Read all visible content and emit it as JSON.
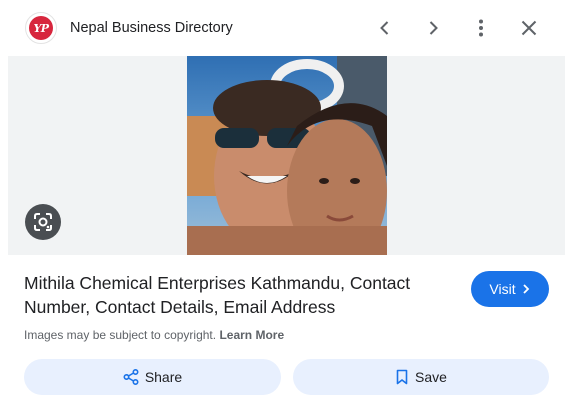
{
  "header": {
    "logo_text": "YP",
    "site_name": "Nepal Business Directory",
    "icons": [
      "chevron-left-icon",
      "chevron-right-icon",
      "more-vert-icon",
      "close-icon"
    ]
  },
  "image": {
    "lens_icon": "google-lens-icon"
  },
  "result": {
    "title": "Mithila Chemical Enterprises Kathmandu, Contact Number, Contact Details, Email Address",
    "visit_label": "Visit",
    "copyright_text": "Images may be subject to copyright.",
    "learn_more": "Learn More"
  },
  "actions": {
    "share_label": "Share",
    "save_label": "Save"
  },
  "colors": {
    "accent": "#1a73e8",
    "button_bg": "#e8f0fe",
    "logo_red": "#d7263d",
    "image_bg": "#f1f3f4"
  }
}
